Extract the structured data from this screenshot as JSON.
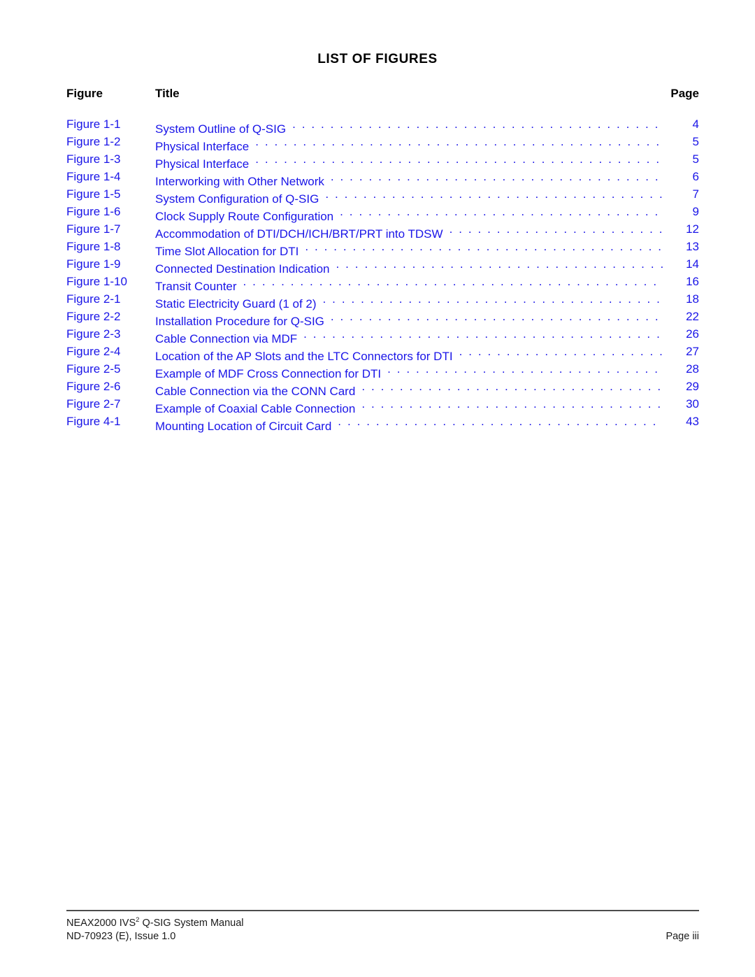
{
  "document": {
    "title": "LIST OF FIGURES",
    "accent_color": "#1a15e8",
    "text_color": "#000000"
  },
  "columns": {
    "figure": "Figure",
    "title": "Title",
    "page": "Page"
  },
  "entries": [
    {
      "label": "Figure 1-1",
      "title": "System Outline of Q-SIG",
      "page": "4"
    },
    {
      "label": "Figure 1-2",
      "title": "Physical Interface",
      "page": "5"
    },
    {
      "label": "Figure 1-3",
      "title": "Physical Interface",
      "page": "5"
    },
    {
      "label": "Figure 1-4",
      "title": "Interworking with Other Network",
      "page": "6"
    },
    {
      "label": "Figure 1-5",
      "title": "System Configuration of Q-SIG",
      "page": "7"
    },
    {
      "label": "Figure 1-6",
      "title": "Clock Supply Route Configuration",
      "page": "9"
    },
    {
      "label": "Figure 1-7",
      "title": "Accommodation of DTI/DCH/ICH/BRT/PRT into TDSW",
      "page": "12"
    },
    {
      "label": "Figure 1-8",
      "title": "Time Slot Allocation for DTI",
      "page": "13"
    },
    {
      "label": "Figure 1-9",
      "title": "Connected Destination Indication",
      "page": "14"
    },
    {
      "label": "Figure 1-10",
      "title": "Transit Counter",
      "page": "16"
    },
    {
      "label": "Figure 2-1",
      "title": "Static Electricity Guard (1 of 2)",
      "page": "18"
    },
    {
      "label": "Figure 2-2",
      "title": "Installation Procedure for Q-SIG",
      "page": "22"
    },
    {
      "label": "Figure 2-3",
      "title": "Cable Connection via MDF",
      "page": "26"
    },
    {
      "label": "Figure 2-4",
      "title": "Location of the AP Slots and the LTC Connectors for DTI",
      "page": "27"
    },
    {
      "label": "Figure 2-5",
      "title": "Example of MDF Cross Connection for DTI",
      "page": "28"
    },
    {
      "label": "Figure 2-6",
      "title": "Cable Connection via the CONN Card",
      "page": "29"
    },
    {
      "label": "Figure 2-7",
      "title": "Example of Coaxial Cable Connection",
      "page": "30"
    },
    {
      "label": "Figure 4-1",
      "title": "Mounting Location of Circuit Card",
      "page": "43"
    }
  ],
  "footer": {
    "manual_line_prefix": "NEAX2000 IVS",
    "manual_line_superscript": "2",
    "manual_line_suffix": " Q-SIG System Manual",
    "document_number": "ND-70923 (E), Issue 1.0",
    "page_label": "Page iii"
  }
}
